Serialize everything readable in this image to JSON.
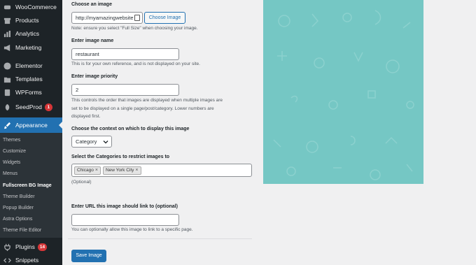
{
  "sidebar": {
    "items": [
      {
        "label": "WooCommerce",
        "icon": "woocommerce-icon"
      },
      {
        "label": "Products",
        "icon": "archive-icon"
      },
      {
        "label": "Analytics",
        "icon": "bar-chart-icon"
      },
      {
        "label": "Marketing",
        "icon": "megaphone-icon"
      },
      {
        "label": "Elementor",
        "icon": "elementor-icon"
      },
      {
        "label": "Templates",
        "icon": "folder-icon"
      },
      {
        "label": "WPForms",
        "icon": "form-icon"
      },
      {
        "label": "SeedProd",
        "icon": "seedprod-icon",
        "badge": "1"
      },
      {
        "label": "Appearance",
        "icon": "paintbrush-icon"
      },
      {
        "label": "Plugins",
        "icon": "plug-icon",
        "badge": "14"
      },
      {
        "label": "Snippets",
        "icon": "code-icon"
      }
    ],
    "submenu": [
      "Themes",
      "Customize",
      "Widgets",
      "Menus",
      "Fullscreen BG Image",
      "Theme Builder",
      "Popup Builder",
      "Astra Options",
      "Theme File Editor"
    ]
  },
  "form": {
    "image_label": "Choose an image",
    "image_url_value": "http://myamazingwebsite",
    "choose_image_button": "Choose Image",
    "image_note": "Note: ensure you select \"Full Size\" when choosing your image.",
    "name_label": "Enter image name",
    "name_value": "restaurant",
    "name_help": "This is for your own reference, and is not displayed on your site.",
    "priority_label": "Enter image priority",
    "priority_value": "2",
    "priority_help_1": "This controls the order that images are displayed when multiple images are",
    "priority_help_2": "set to be displayed on a single page/post/category. Lower numbers are",
    "priority_help_3": "displayed first.",
    "context_label": "Choose the context on which to display this image",
    "context_value": "Category",
    "categories_label": "Select the Categories to restrict images to",
    "categories": [
      "Chicago",
      "New York City"
    ],
    "categories_optional": "(Optional)",
    "link_label": "Enter URL this image should link to (optional)",
    "link_value": "",
    "link_help": "You can optionally allow this image to link to a specific page.",
    "save_button": "Save Image"
  },
  "colors": {
    "sidebar_bg": "#1d2327",
    "accent": "#2271b1",
    "preview_bg": "#75c7c4"
  }
}
